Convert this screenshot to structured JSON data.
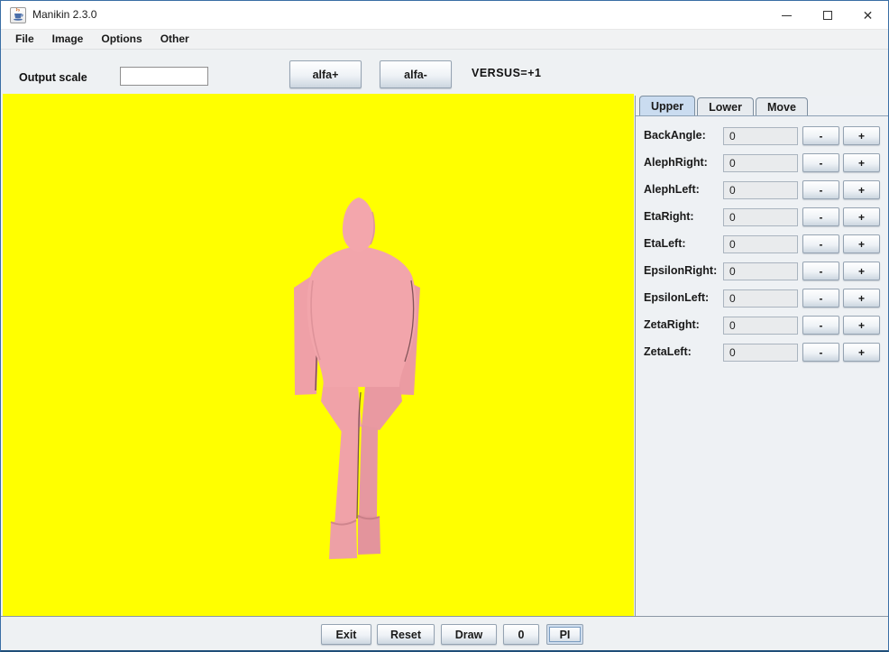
{
  "window": {
    "title": "Manikin 2.3.0",
    "controls": {
      "minimize": "minimize",
      "maximize": "maximize",
      "close": "close"
    }
  },
  "menu": {
    "items": [
      {
        "label": "File"
      },
      {
        "label": "Image"
      },
      {
        "label": "Options"
      },
      {
        "label": "Other"
      }
    ]
  },
  "toolbar": {
    "output_scale_label": "Output scale",
    "output_scale_value": "",
    "alfa_plus_label": "alfa+",
    "alfa_minus_label": "alfa-",
    "versus_label": "VERSUS=+1"
  },
  "panel": {
    "tabs": [
      {
        "label": "Upper",
        "selected": true
      },
      {
        "label": "Lower",
        "selected": false
      },
      {
        "label": "Move",
        "selected": false
      }
    ],
    "minus_label": "-",
    "plus_label": "+",
    "rows": [
      {
        "label": "BackAngle:",
        "value": "0"
      },
      {
        "label": "AlephRight:",
        "value": "0"
      },
      {
        "label": "AlephLeft:",
        "value": "0"
      },
      {
        "label": "EtaRight:",
        "value": "0"
      },
      {
        "label": "EtaLeft:",
        "value": "0"
      },
      {
        "label": "EpsilonRight:",
        "value": "0"
      },
      {
        "label": "EpsilonLeft:",
        "value": "0"
      },
      {
        "label": "ZetaRight:",
        "value": "0"
      },
      {
        "label": "ZetaLeft:",
        "value": "0"
      }
    ]
  },
  "bottom": {
    "exit_label": "Exit",
    "reset_label": "Reset",
    "draw_label": "Draw",
    "zero_label": "0",
    "pi_label": "PI"
  },
  "canvas": {
    "background_color": "#ffff00",
    "figure_color": "#f2a5ab",
    "figure": "manikin-front-view"
  }
}
